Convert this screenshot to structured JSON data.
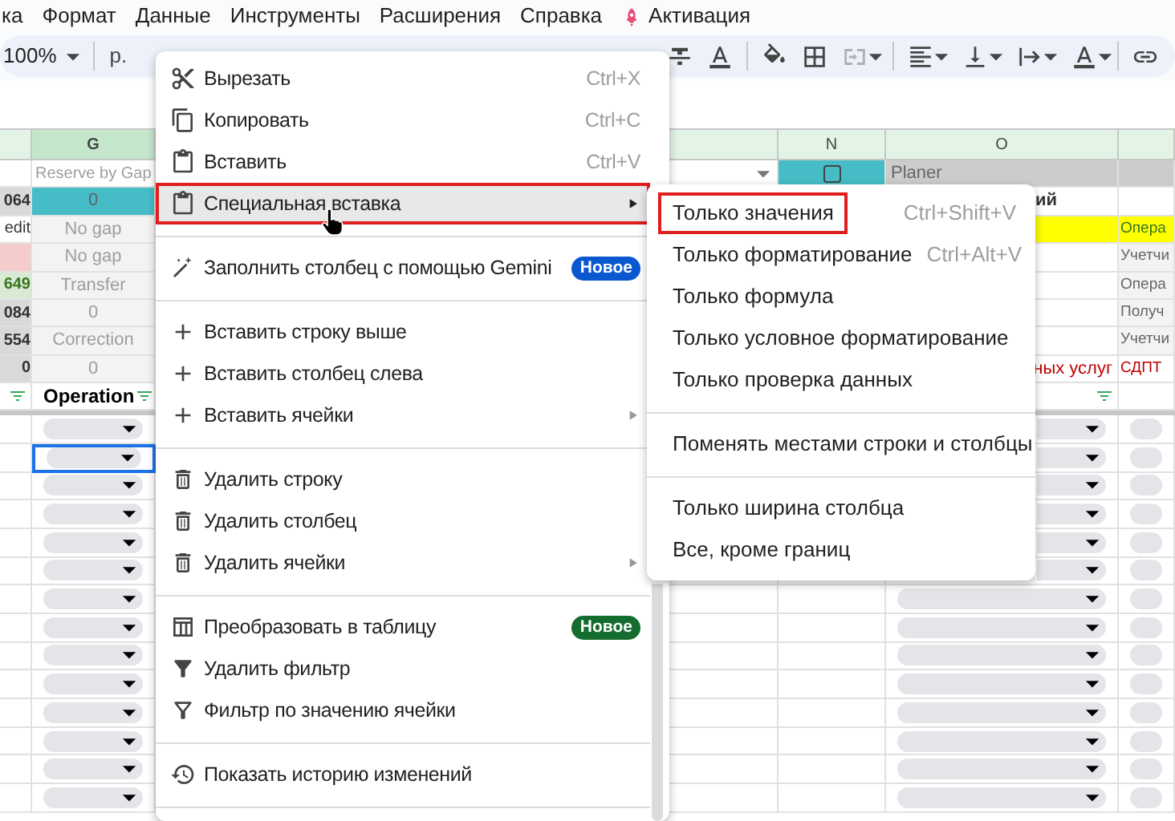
{
  "menu_bar": [
    {
      "label": "ка"
    },
    {
      "label": "Формат"
    },
    {
      "label": "Данные"
    },
    {
      "label": "Инструменты"
    },
    {
      "label": "Расширения"
    },
    {
      "label": "Справка"
    },
    {
      "label": "Активация",
      "kind": "rocket"
    }
  ],
  "toolbar": {
    "zoom": "100%",
    "currency": "р."
  },
  "column_headers": [
    {
      "selected": false
    },
    {
      "label": "G",
      "selected": true
    },
    {
      "selected": false
    },
    {
      "label": "N",
      "selected": false
    },
    {
      "label": "O",
      "selected": false
    },
    {
      "selected": false
    }
  ],
  "top_rows": [
    {
      "cells": [
        {
          "kind": "blank"
        },
        {
          "kind": "muted",
          "text": "Reserve by Gap"
        },
        {
          "kind": "dropdown"
        },
        {
          "kind": "checkbox",
          "checked": false
        },
        {
          "kind": "gray",
          "text": "Planer"
        },
        {
          "kind": "gray"
        }
      ]
    },
    {
      "cells": [
        {
          "kind": "total",
          "text": "064"
        },
        {
          "kind": "teal",
          "text": "0"
        },
        {
          "kind": "blank"
        },
        {
          "kind": "blank"
        },
        {
          "kind": "tail_bold",
          "text": "ий"
        },
        {
          "kind": "blank"
        }
      ]
    },
    {
      "cells": [
        {
          "kind": "text",
          "text": "edit"
        },
        {
          "kind": "label",
          "text": "No gap"
        },
        {
          "kind": "blank"
        },
        {
          "kind": "blank"
        },
        {
          "kind": "yellow"
        },
        {
          "kind": "yellow",
          "text": "Опера"
        }
      ]
    },
    {
      "cells": [
        {
          "kind": "pink"
        },
        {
          "kind": "label",
          "text": "No gap"
        },
        {
          "kind": "blank"
        },
        {
          "kind": "blank"
        },
        {
          "kind": "blank"
        },
        {
          "kind": "note",
          "text": "Учетчи"
        }
      ]
    },
    {
      "cells": [
        {
          "kind": "total_green",
          "text": "649"
        },
        {
          "kind": "label",
          "text": "Transfer"
        },
        {
          "kind": "blank"
        },
        {
          "kind": "blank"
        },
        {
          "kind": "blank"
        },
        {
          "kind": "note",
          "text": "Опера"
        }
      ]
    },
    {
      "cells": [
        {
          "kind": "total",
          "text": "084"
        },
        {
          "kind": "label",
          "text": "0"
        },
        {
          "kind": "blank"
        },
        {
          "kind": "blank"
        },
        {
          "kind": "blank"
        },
        {
          "kind": "note",
          "text": "Получ"
        }
      ]
    },
    {
      "cells": [
        {
          "kind": "total",
          "text": "554"
        },
        {
          "kind": "label",
          "text": "Correction"
        },
        {
          "kind": "blank"
        },
        {
          "kind": "blank"
        },
        {
          "kind": "blank"
        },
        {
          "kind": "note",
          "text": "Учетчи"
        }
      ]
    },
    {
      "cells": [
        {
          "kind": "total",
          "text": "0"
        },
        {
          "kind": "label",
          "text": "0"
        },
        {
          "kind": "blank"
        },
        {
          "kind": "blank"
        },
        {
          "kind": "red_right",
          "text": "ных услуг"
        },
        {
          "kind": "red",
          "text": "СДПТ"
        }
      ]
    },
    {
      "cells": [
        {
          "kind": "filter"
        },
        {
          "kind": "header",
          "text": "Operation"
        },
        {
          "kind": "blank"
        },
        {
          "kind": "blank"
        },
        {
          "kind": "filter"
        },
        {
          "kind": "blank"
        }
      ]
    }
  ],
  "chip_rows": [
    {
      "selected": false
    },
    {
      "selected": true
    },
    {
      "selected": false
    },
    {
      "selected": false
    },
    {
      "selected": false
    },
    {
      "selected": false
    },
    {
      "selected": false
    },
    {
      "selected": false
    },
    {
      "selected": false
    },
    {
      "selected": false
    },
    {
      "selected": false
    },
    {
      "selected": false
    },
    {
      "selected": false
    },
    {
      "selected": false
    }
  ],
  "context_menu": {
    "items": [
      {
        "kind": "item",
        "label": "Вырезать",
        "shortcut": "Ctrl+X",
        "submenu": false,
        "selected": false,
        "outlined": false
      },
      {
        "kind": "item",
        "label": "Копировать",
        "shortcut": "Ctrl+C",
        "submenu": false,
        "selected": false,
        "outlined": false
      },
      {
        "kind": "item",
        "label": "Вставить",
        "shortcut": "Ctrl+V",
        "submenu": false,
        "selected": false,
        "outlined": false
      },
      {
        "kind": "item",
        "label": "Специальная вставка",
        "submenu": true,
        "selected": true,
        "outlined": true
      },
      {
        "kind": "divider"
      },
      {
        "kind": "item",
        "label": "Заполнить столбец с помощью Gemini",
        "badge": {
          "text": "Новое",
          "color": "#0b57d0"
        },
        "submenu": false,
        "selected": false,
        "outlined": false
      },
      {
        "kind": "divider"
      },
      {
        "kind": "item",
        "label": "Вставить строку выше",
        "submenu": false,
        "selected": false,
        "outlined": false
      },
      {
        "kind": "item",
        "label": "Вставить столбец слева",
        "submenu": false,
        "selected": false,
        "outlined": false
      },
      {
        "kind": "item",
        "label": "Вставить ячейки",
        "submenu": true,
        "selected": false,
        "outlined": false
      },
      {
        "kind": "divider"
      },
      {
        "kind": "item",
        "label": "Удалить строку",
        "submenu": false,
        "selected": false,
        "outlined": false
      },
      {
        "kind": "item",
        "label": "Удалить столбец",
        "submenu": false,
        "selected": false,
        "outlined": false
      },
      {
        "kind": "item",
        "label": "Удалить ячейки",
        "submenu": true,
        "selected": false,
        "outlined": false
      },
      {
        "kind": "divider"
      },
      {
        "kind": "item",
        "label": "Преобразовать в таблицу",
        "badge": {
          "text": "Новое",
          "color": "#146c2e"
        },
        "submenu": false,
        "selected": false,
        "outlined": false
      },
      {
        "kind": "item",
        "label": "Удалить фильтр",
        "submenu": false,
        "selected": false,
        "outlined": false
      },
      {
        "kind": "item",
        "label": "Фильтр по значению ячейки",
        "submenu": false,
        "selected": false,
        "outlined": false
      },
      {
        "kind": "divider"
      },
      {
        "kind": "item",
        "label": "Показать историю изменений",
        "submenu": false,
        "selected": false,
        "outlined": false
      },
      {
        "kind": "divider"
      }
    ]
  },
  "paste_special_menu": {
    "items": [
      {
        "kind": "item",
        "label": "Только значения",
        "shortcut": "Ctrl+Shift+V",
        "selected": false,
        "outlined": true
      },
      {
        "kind": "item",
        "label": "Только форматирование",
        "shortcut": "Ctrl+Alt+V",
        "selected": false,
        "outlined": false
      },
      {
        "kind": "item",
        "label": "Только формула",
        "selected": false,
        "outlined": false
      },
      {
        "kind": "item",
        "label": "Только условное форматирование",
        "selected": false,
        "outlined": false
      },
      {
        "kind": "item",
        "label": "Только проверка данных",
        "selected": false,
        "outlined": false
      },
      {
        "kind": "divider"
      },
      {
        "kind": "item",
        "label": "Поменять местами строки и столбцы",
        "selected": false,
        "outlined": false
      },
      {
        "kind": "divider"
      },
      {
        "kind": "item",
        "label": "Только ширина столбца",
        "selected": false,
        "outlined": false
      },
      {
        "kind": "item",
        "label": "Все, кроме границ",
        "selected": false,
        "outlined": false
      }
    ]
  }
}
